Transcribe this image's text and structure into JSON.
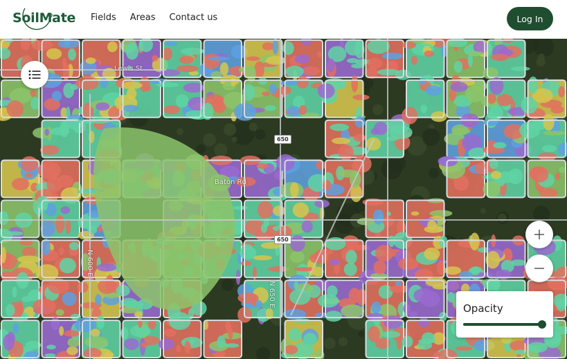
{
  "header": {
    "logo_text": "SoilMate",
    "nav": [
      {
        "label": "Fields"
      },
      {
        "label": "Areas"
      },
      {
        "label": "Contact us"
      }
    ],
    "login_label": "Log In"
  },
  "map": {
    "road_labels": [
      "Baton Rd",
      "N 650 E",
      "N 600 E",
      "Lewis St"
    ],
    "shields": [
      "650",
      "650"
    ],
    "opacity_label": "Opacity",
    "opacity_value": 0.96,
    "colors": {
      "accent": "#1f4d30",
      "soil_red": "#e2705f",
      "soil_teal": "#5fd3a4",
      "soil_purple": "#9a6ad0",
      "soil_blue": "#5ea0e0",
      "soil_yellow": "#d6c64e",
      "soil_green": "#8cc46b"
    }
  },
  "icons": {
    "layers": "list-icon",
    "zoom_in": "plus-icon",
    "zoom_out": "minus-icon"
  }
}
